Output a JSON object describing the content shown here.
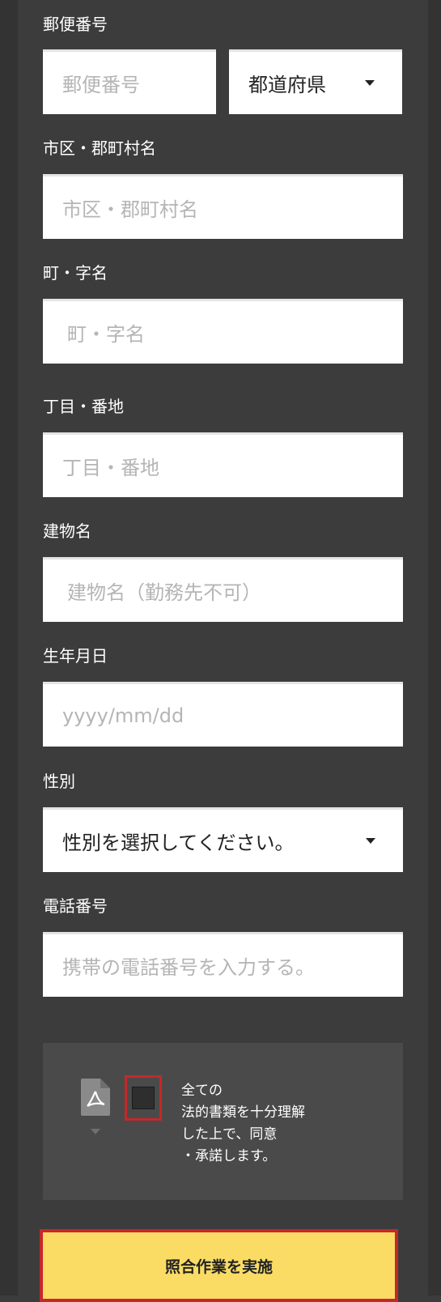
{
  "postal": {
    "label": "郵便番号",
    "placeholder": "郵便番号",
    "prefecture_value": "都道府県"
  },
  "city": {
    "label": "市区・郡町村名",
    "placeholder": "市区・郡町村名"
  },
  "town": {
    "label": "町・字名",
    "placeholder": "町・字名"
  },
  "block": {
    "label": "丁目・番地",
    "placeholder": "丁目・番地"
  },
  "building": {
    "label": "建物名",
    "placeholder": "建物名（勤務先不可）"
  },
  "birthdate": {
    "label": "生年月日",
    "placeholder": "yyyy/mm/dd"
  },
  "gender": {
    "label": "性別",
    "value": "性別を選択してください。"
  },
  "phone": {
    "label": "電話番号",
    "placeholder": "携帯の電話番号を入力する。"
  },
  "consent": {
    "text": "全ての\n法的書類を十分理解\nした上で、同意\n・承諾します。",
    "checked": false
  },
  "submit_label": "照合作業を実施",
  "colors": {
    "background": "#3c3c3c",
    "button": "#fadc65",
    "highlight": "#c62828"
  }
}
